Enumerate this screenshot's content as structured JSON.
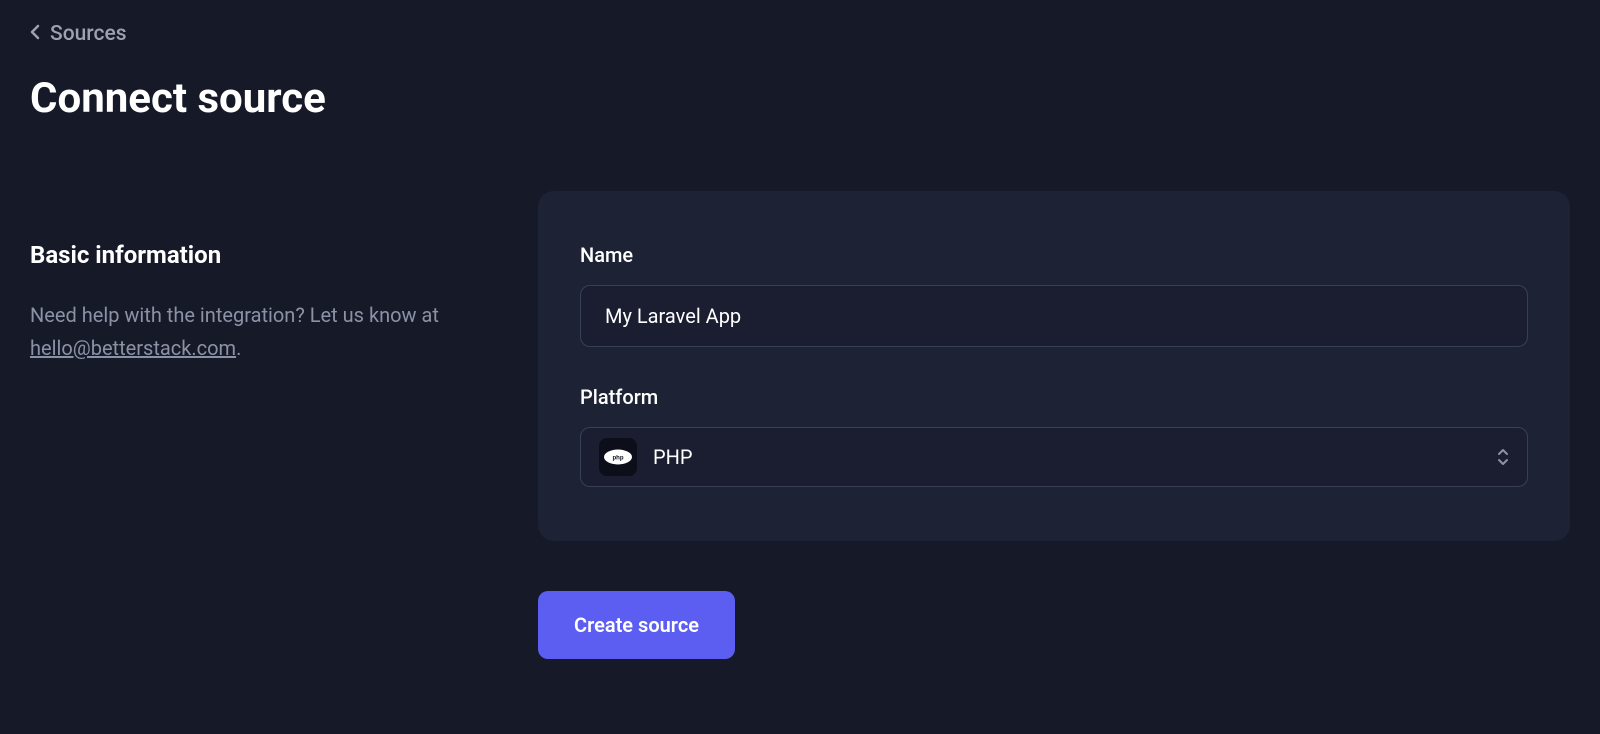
{
  "breadcrumb": {
    "label": "Sources"
  },
  "page": {
    "title": "Connect source"
  },
  "sidebar": {
    "section_title": "Basic information",
    "help_text_prefix": "Need help with the integration? Let us know at ",
    "help_email": "hello@betterstack.com",
    "help_text_suffix": "."
  },
  "form": {
    "name_label": "Name",
    "name_value": "My Laravel App",
    "platform_label": "Platform",
    "platform_value": "PHP",
    "submit_label": "Create source"
  }
}
